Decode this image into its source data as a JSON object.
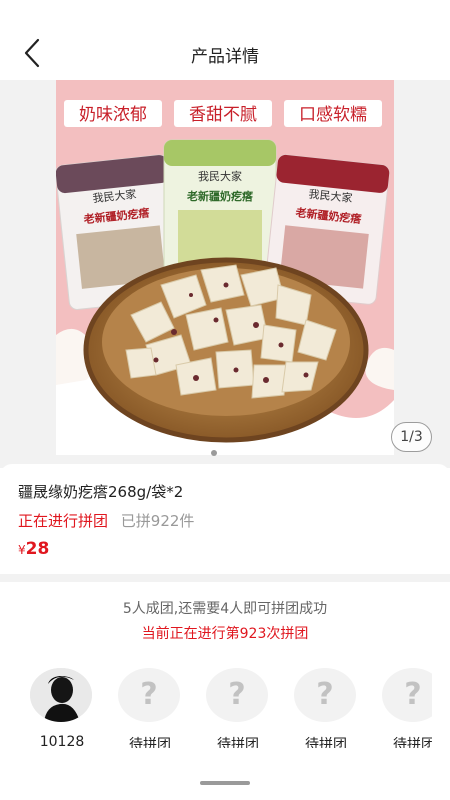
{
  "nav": {
    "title": "产品详情",
    "back_icon": "chevron-left-icon"
  },
  "gallery": {
    "page_indicator": "1/3",
    "image_banners": [
      "奶味浓郁",
      "香甜不腻",
      "口感软糯"
    ],
    "brand_mark": "我民大家",
    "package_name": "老新疆奶疙瘩"
  },
  "product": {
    "name": "疆晟缘奶疙瘩268g/袋*2",
    "status": "正在进行拼团",
    "joined": "已拼922件",
    "currency": "¥",
    "price": "28"
  },
  "group": {
    "hint": "5人成团,还需要4人即可拼团成功",
    "current": "当前正在进行第923次拼团",
    "members": [
      {
        "label": "10128",
        "avatar": "user-photo"
      },
      {
        "label": "待拼团",
        "avatar": "?"
      },
      {
        "label": "待拼团",
        "avatar": "?"
      },
      {
        "label": "待拼团",
        "avatar": "?"
      },
      {
        "label": "待拼团",
        "avatar": "?"
      }
    ]
  },
  "colors": {
    "accent_red": "#e0171f",
    "muted_text": "#999999",
    "image_background": "#f3bfc0"
  }
}
